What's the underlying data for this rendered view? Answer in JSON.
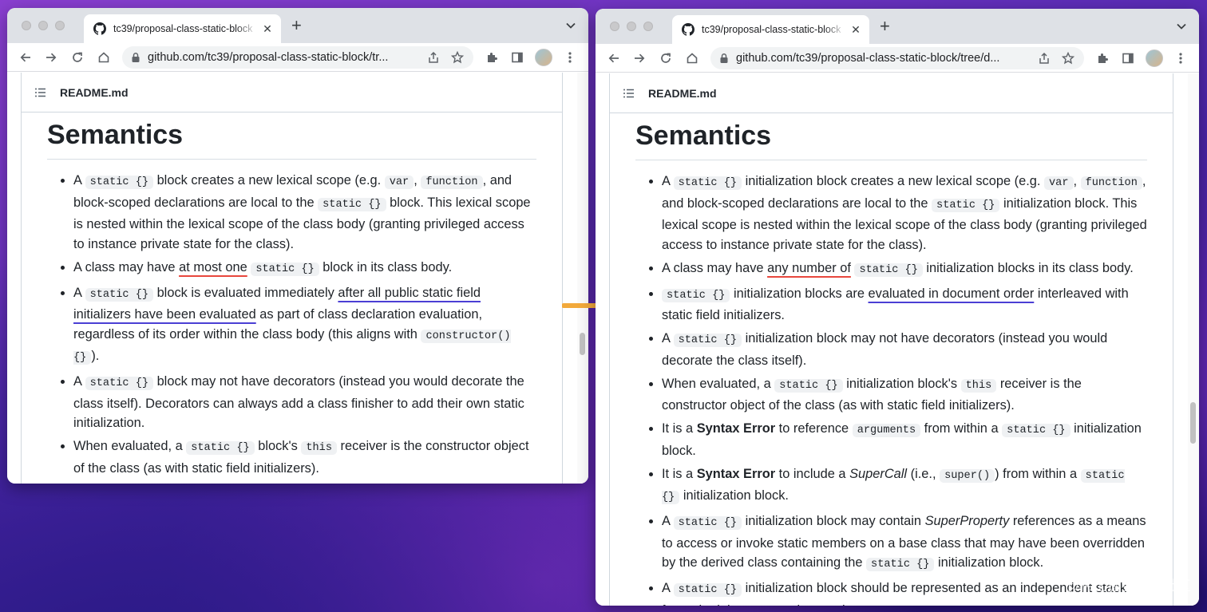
{
  "colors": {
    "underline_red": "#e8473d",
    "underline_blue": "#4b3fd4",
    "arrow": "#f2a93b"
  },
  "left_window": {
    "tab_title": "tc39/proposal-class-static-block",
    "url": "github.com/tc39/proposal-class-static-block/tr...",
    "readme_name": "README.md",
    "heading": "Semantics"
  },
  "right_window": {
    "tab_title": "tc39/proposal-class-static-block",
    "url": "github.com/tc39/proposal-class-static-block/tree/d...",
    "readme_name": "README.md",
    "heading": "Semantics"
  },
  "left_bullets": [
    {
      "t1": "A ",
      "c1": "static {}",
      "t2": " block creates a new lexical scope (e.g. ",
      "c2": "var",
      "t3": ", ",
      "c3": "function",
      "t4": ", and block-scoped declarations are local to the ",
      "c4": "static {}",
      "t5": " block. This lexical scope is nested within the lexical scope of the class body (granting privileged access to instance private state for the class)."
    },
    {
      "t1": "A class may have ",
      "u1": "at most one",
      "t2": " ",
      "c1": "static {}",
      "t3": " block in its class body."
    },
    {
      "t1": "A ",
      "c1": "static {}",
      "t2": " block is evaluated immediately ",
      "u1": "after all public static field initializers have been evaluated",
      "t3": " as part of class declaration evaluation, regardless of its order within the class body (this aligns with ",
      "c2": "constructor() {}",
      "t4": ")."
    },
    {
      "t1": "A ",
      "c1": "static {}",
      "t2": " block may not have decorators (instead you would decorate the class itself). Decorators can always add a class finisher to add their own static initialization."
    },
    {
      "t1": "When evaluated, a ",
      "c1": "static {}",
      "t2": " block's ",
      "c2": "this",
      "t3": " receiver is the constructor object of the class (as with static field initializers)."
    }
  ],
  "right_bullets": [
    {
      "t1": "A ",
      "c1": "static {}",
      "t2": " initialization block creates a new lexical scope (e.g. ",
      "c2": "var",
      ",": ", ",
      "c3": "function",
      "t3": ", and block-scoped declarations are local to the ",
      "c4": "static {}",
      "t4": " initialization block. This lexical scope is nested within the lexical scope of the class body (granting privileged access to instance private state for the class)."
    },
    {
      "t1": "A class may have ",
      "u1": "any number of",
      "t2": " ",
      "c1": "static {}",
      "t3": " initialization blocks in its class body."
    },
    {
      "c1": "static {}",
      "t1": " initialization blocks are ",
      "u1": "evaluated in document order",
      "t2": " interleaved with static field initializers."
    },
    {
      "t1": "A ",
      "c1": "static {}",
      "t2": " initialization block may not have decorators (instead you would decorate the class itself)."
    },
    {
      "t1": "When evaluated, a ",
      "c1": "static {}",
      "t2": " initialization block's ",
      "c2": "this",
      "t3": " receiver is the constructor object of the class (as with static field initializers)."
    },
    {
      "t1": "It is a ",
      "b1": "Syntax Error",
      "t2": " to reference ",
      "c1": "arguments",
      "t3": " from within a ",
      "c2": "static {}",
      "t4": " initialization block."
    },
    {
      "t1": "It is a ",
      "b1": "Syntax Error",
      "t2": " to include a ",
      "i1": "SuperCall",
      "t3": " (i.e., ",
      "c1": "super()",
      "t4": ") from within a ",
      "c2": "static {}",
      "t5": " initialization block."
    },
    {
      "t1": "A ",
      "c1": "static {}",
      "t2": " initialization block may contain ",
      "i1": "SuperProperty",
      "t3": " references as a means to access or invoke static members on a base class that may have been overridden by the derived class containing the ",
      "c2": "static {}",
      "t4": " initialization block."
    },
    {
      "t1": "A ",
      "c1": "static {}",
      "t2": " initialization block should be represented as an independent stack frame in debuggers and exception traces."
    }
  ],
  "watermark": "@稀土掘金技术社区"
}
